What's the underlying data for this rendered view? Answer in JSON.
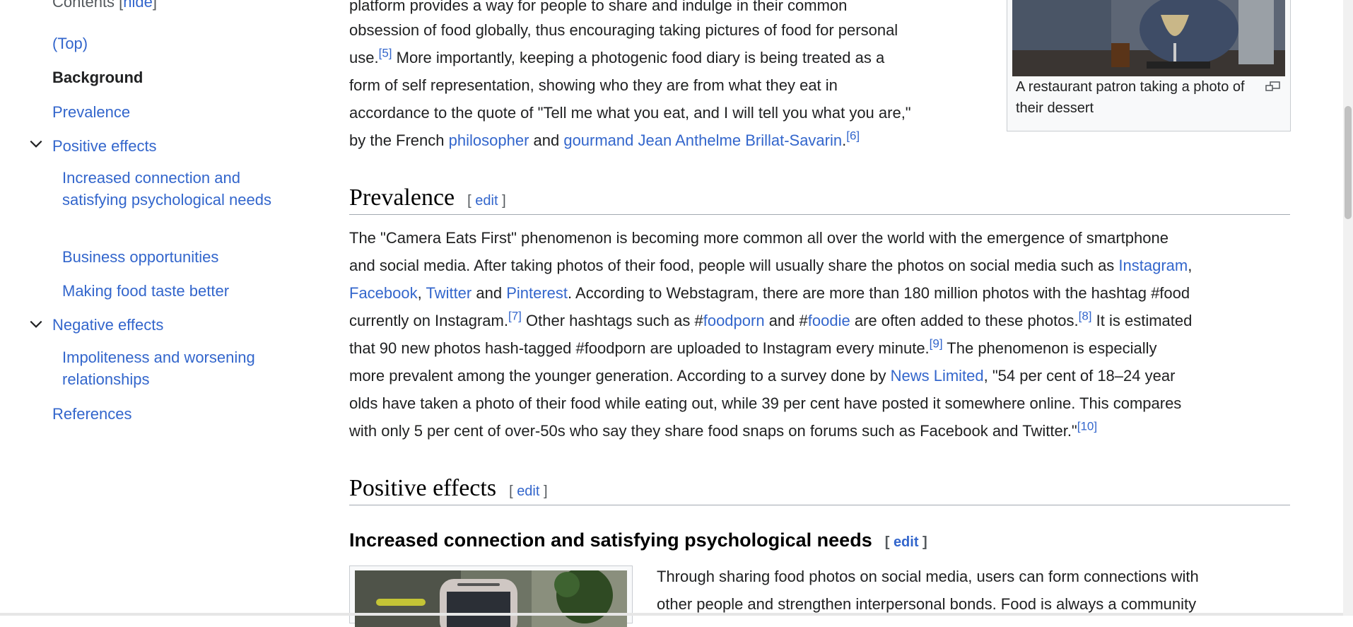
{
  "toc": {
    "heading": "Contents",
    "hide_label": "hide",
    "items": [
      {
        "label": "(Top)"
      },
      {
        "label": "Background"
      },
      {
        "label": "Prevalence"
      },
      {
        "label": "Positive effects"
      },
      {
        "label": "Increased connection and satisfying psychological needs"
      },
      {
        "label": "Business opportunities"
      },
      {
        "label": "Making food taste better"
      },
      {
        "label": "Negative effects"
      },
      {
        "label": "Impoliteness and worsening relationships"
      },
      {
        "label": "References"
      }
    ]
  },
  "background": {
    "line1": "platform provides a way for people to share and indulge in their common",
    "line2": "obsession of food globally, thus encouraging taking pictures of food for personal",
    "line3a": "use.",
    "ref5": "[5]",
    "line3b": " More importantly, keeping a photogenic food diary is being treated as a",
    "line4": "form of self representation, showing who they are from what they eat in",
    "line5": "accordance to the quote of \"Tell me what you eat, and I will tell you what you are,\"",
    "line6a": "by the French ",
    "link_philosopher": "philosopher",
    "line6b": " and ",
    "link_gourmand": "gourmand",
    "line6c": " ",
    "link_brillat": "Jean Anthelme Brillat-Savarin",
    "line6d": ".",
    "ref6": "[6]"
  },
  "figure_top": {
    "caption": "A restaurant patron taking a photo of their dessert"
  },
  "prevalence": {
    "heading": "Prevalence",
    "edit_label": "edit",
    "p1": "The \"Camera Eats First\" phenomenon is becoming more common all over the world with the emergence of smartphone",
    "p2a": "and social media. After taking photos of their food, people will usually share the photos on social media such as ",
    "link_instagram": "Instagram",
    "p2b": ",",
    "link_facebook": "Facebook",
    "p3a": ", ",
    "link_twitter": "Twitter",
    "p3b": " and ",
    "link_pinterest": "Pinterest",
    "p3c": ". According to Webstagram, there are more than 180 million photos with the hashtag #food",
    "p4a": "currently on Instagram.",
    "ref7": "[7]",
    "p4b": " Other hashtags such as #",
    "link_foodporn": "foodporn",
    "p4c": " and #",
    "link_foodie": "foodie",
    "p4d": " are often added to these photos.",
    "ref8": "[8]",
    "p4e": " It is estimated",
    "p5a": "that 90 new photos hash-tagged #foodporn are uploaded to Instagram every minute.",
    "ref9": "[9]",
    "p5b": " The phenomenon is especially",
    "p6a": "more prevalent among the younger generation. According to a survey done by ",
    "link_news": "News Limited",
    "p6b": ", \"54 per cent of 18–24 year",
    "p7": "olds have taken a photo of their food while eating out, while 39 per cent have posted it somewhere online. This compares",
    "p8": "with only 5 per cent of over-50s who say they share food snaps on forums such as Facebook and Twitter.\"",
    "ref10": "[10]"
  },
  "positive": {
    "heading": "Positive effects",
    "edit_label": "edit"
  },
  "increased": {
    "heading": "Increased connection and satisfying psychological needs",
    "edit_label": "edit",
    "l1": "Through sharing food photos on social media, users can form connections with",
    "l2": "other people and strengthen interpersonal bonds. Food is always a community"
  }
}
